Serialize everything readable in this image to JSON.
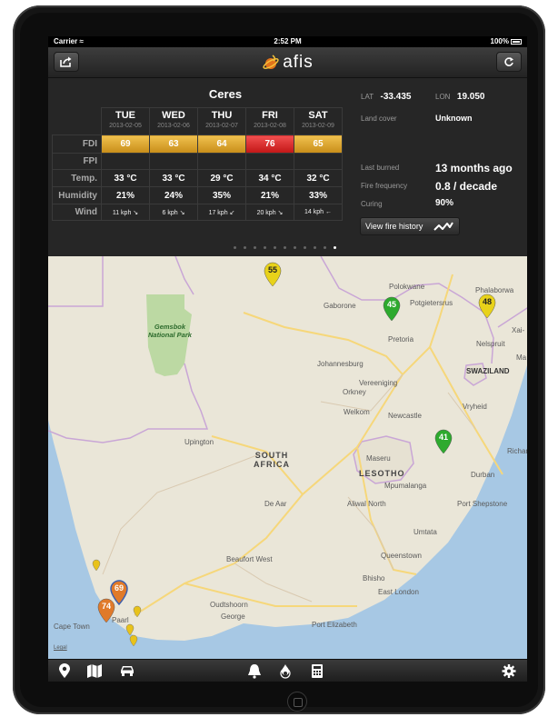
{
  "status_bar": {
    "carrier": "Carrier",
    "time": "2:52 PM",
    "battery": "100%"
  },
  "nav": {
    "brand": "afis",
    "share_icon": "share-icon",
    "refresh_icon": "refresh-icon"
  },
  "forecast": {
    "location": "Ceres",
    "row_labels": {
      "fdi": "FDI",
      "fpi": "FPI",
      "temp": "Temp.",
      "humidity": "Humidity",
      "wind": "Wind"
    },
    "days": [
      {
        "name": "TUE",
        "date": "2013-02-05",
        "fdi": "69",
        "temp": "33 °C",
        "humidity": "21%",
        "wind": "11 kph ↘"
      },
      {
        "name": "WED",
        "date": "2013-02-06",
        "fdi": "63",
        "temp": "33 °C",
        "humidity": "24%",
        "wind": "6 kph ↘"
      },
      {
        "name": "THU",
        "date": "2013-02-07",
        "fdi": "64",
        "temp": "29 °C",
        "humidity": "35%",
        "wind": "17 kph ↙"
      },
      {
        "name": "FRI",
        "date": "2013-02-08",
        "fdi": "76",
        "temp": "34 °C",
        "humidity": "21%",
        "wind": "20 kph ↘"
      },
      {
        "name": "SAT",
        "date": "2013-02-09",
        "fdi": "65",
        "temp": "32 °C",
        "humidity": "33%",
        "wind": "14 kph ←"
      }
    ],
    "fdi_colors": {
      "normal": "#e0a833",
      "high": "#d62a2a"
    }
  },
  "info": {
    "lat_label": "LAT",
    "lat": "-33.435",
    "lon_label": "LON",
    "lon": "19.050",
    "land_cover_label": "Land cover",
    "land_cover": "Unknown",
    "last_burned_label": "Last burned",
    "last_burned": "13 months ago",
    "fire_frequency_label": "Fire frequency",
    "fire_frequency": "0.8 / decade",
    "curing_label": "Curing",
    "curing": "90%",
    "history_button": "View fire history"
  },
  "pager": {
    "pages": 11,
    "active_index": 10
  },
  "map": {
    "places": {
      "polokwane": "Polokwane",
      "phalaborwa": "Phalaborwa",
      "gaborone": "Gaborone",
      "potgietersrus": "Potgietersrus",
      "xai": "Xai-",
      "pretoria": "Pretoria",
      "nelspruit": "Nelspruit",
      "ma": "Ma",
      "johannesburg": "Johannesburg",
      "swaziland": "SWAZILAND",
      "orkney": "Orkney",
      "vereeniging": "Vereeniging",
      "welkom": "Welkom",
      "newcastle": "Newcastle",
      "vryheid": "Vryheid",
      "upington": "Upington",
      "south_africa": "SOUTH\nAFRICA",
      "maseru": "Maseru",
      "lesotho": "LESOTHO",
      "richards": "Richar",
      "durban": "Durban",
      "mpumalanga": "Mpumalanga",
      "de_aar": "De Aar",
      "aliwal_north": "Aliwal North",
      "port_shepstone": "Port Shepstone",
      "umtata": "Umtata",
      "queenstown": "Queenstown",
      "beaufort_west": "Beaufort West",
      "bhisho": "Bhisho",
      "east_london": "East London",
      "oudtshoorn": "Oudtshoorn",
      "paarl": "Paarl",
      "george": "George",
      "cape_town": "Cape Town",
      "port_elizabeth": "Port Elizabeth",
      "gemsbok": "Gemsbok\nNational Park",
      "legal": "Legal"
    },
    "markers": [
      {
        "value": "55",
        "color": "#e8d21a"
      },
      {
        "value": "45",
        "color": "#2eaa2e"
      },
      {
        "value": "48",
        "color": "#e8d21a"
      },
      {
        "value": "41",
        "color": "#2eaa2e"
      },
      {
        "value": "69",
        "color": "#e07a2a"
      },
      {
        "value": "74",
        "color": "#e07a2a"
      }
    ],
    "colors": {
      "land": "#eae6d8",
      "sea": "#a7c8e4",
      "park": "#bcd9a3",
      "border": "#c9a6d6",
      "road": "#f6d77a"
    }
  },
  "tabbar": {
    "icons": [
      "map-pin-icon",
      "map-icon",
      "car-icon",
      "bell-icon",
      "fire-badge-icon",
      "calculator-icon",
      "gear-icon"
    ]
  }
}
